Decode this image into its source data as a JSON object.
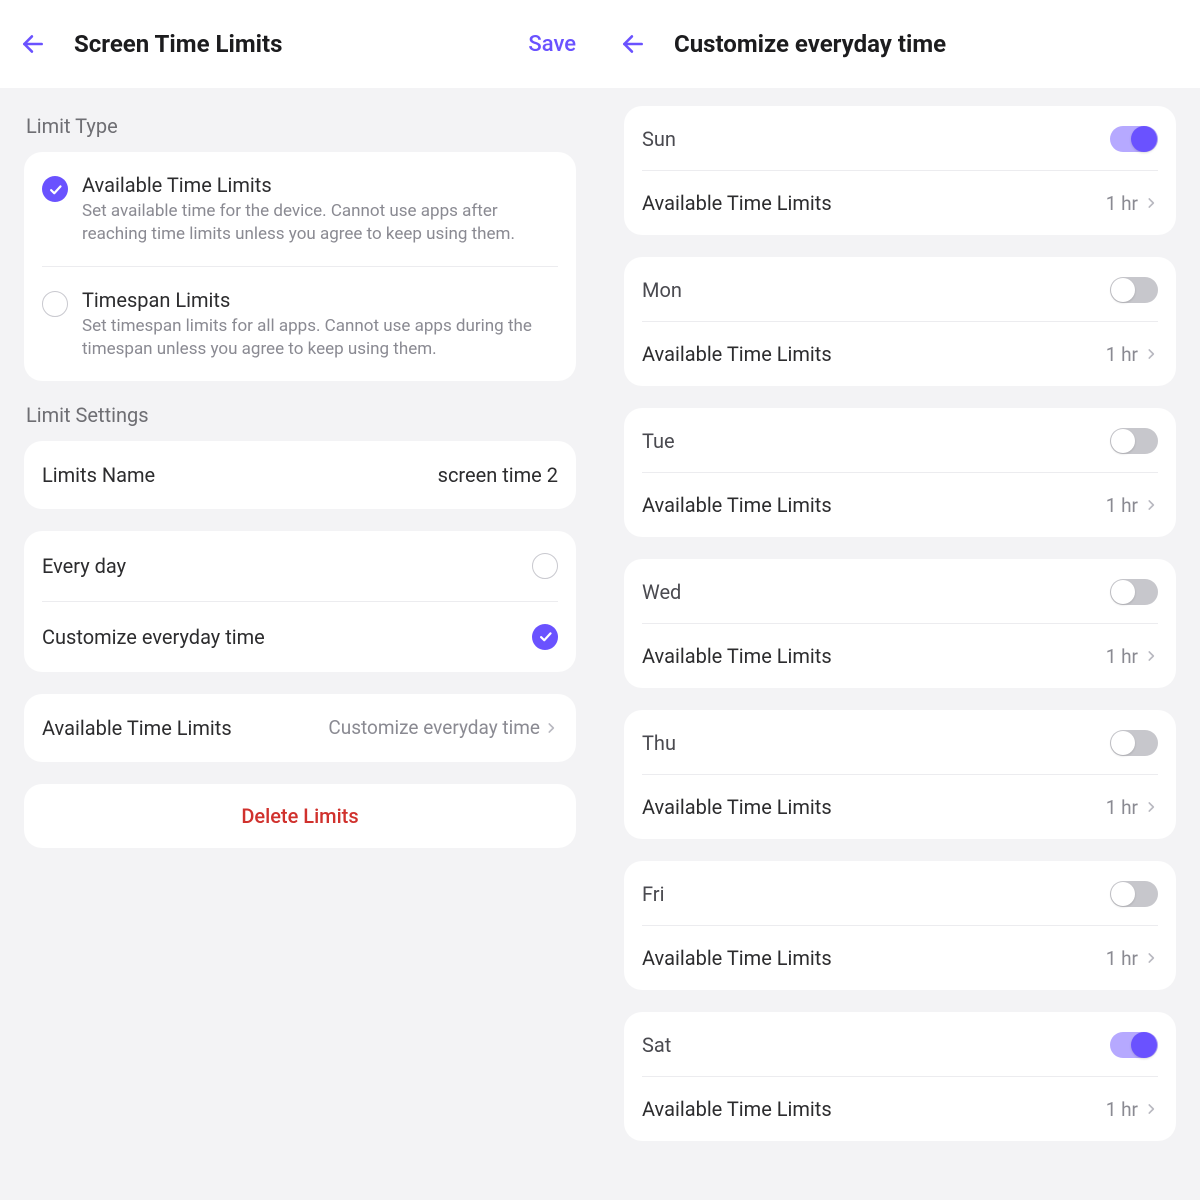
{
  "left": {
    "title": "Screen Time Limits",
    "save": "Save",
    "section_limit_type": "Limit Type",
    "opt1_title": "Available Time Limits",
    "opt1_desc": "Set available time for the device. Cannot use apps after reaching time limits unless you agree to keep using them.",
    "opt2_title": "Timespan Limits",
    "opt2_desc": "Set timespan limits for all apps. Cannot use apps during the timespan unless you agree to keep using them.",
    "section_limit_settings": "Limit Settings",
    "limits_name_label": "Limits Name",
    "limits_name_value": "screen time 2",
    "every_day": "Every day",
    "customize": "Customize everyday time",
    "atl_label": "Available Time Limits",
    "atl_value": "Customize everyday time",
    "delete": "Delete Limits"
  },
  "right": {
    "title": "Customize everyday time",
    "row_label": "Available Time Limits",
    "days": [
      {
        "name": "Sun",
        "on": true,
        "value": "1 hr"
      },
      {
        "name": "Mon",
        "on": false,
        "value": "1 hr"
      },
      {
        "name": "Tue",
        "on": false,
        "value": "1 hr"
      },
      {
        "name": "Wed",
        "on": false,
        "value": "1 hr"
      },
      {
        "name": "Thu",
        "on": false,
        "value": "1 hr"
      },
      {
        "name": "Fri",
        "on": false,
        "value": "1 hr"
      },
      {
        "name": "Sat",
        "on": true,
        "value": "1 hr"
      }
    ]
  },
  "colors": {
    "accent": "#6a52ff",
    "danger": "#d0312d"
  }
}
